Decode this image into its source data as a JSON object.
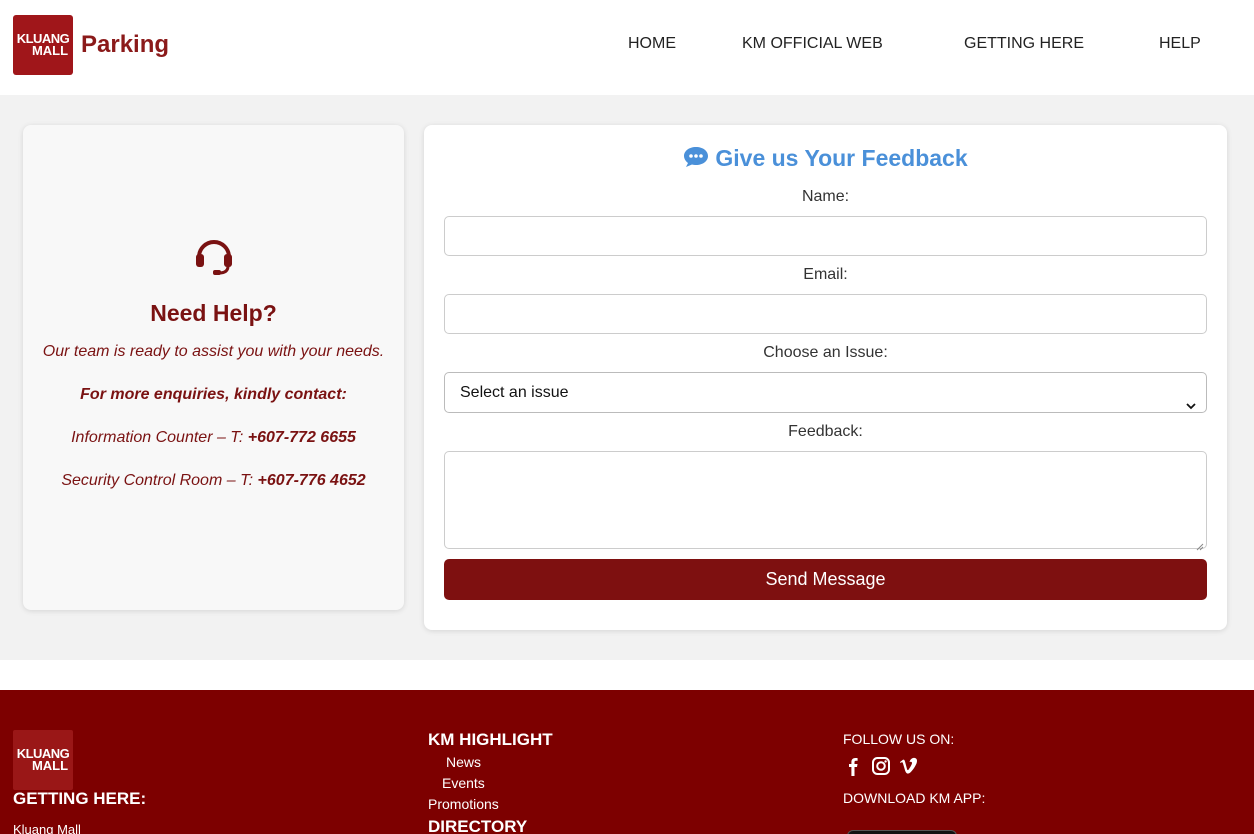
{
  "header": {
    "logo_line1": "KLUANG",
    "logo_line2": "MALL",
    "brand": "Parking",
    "nav": [
      "HOME",
      "KM OFFICIAL WEB",
      "GETTING HERE",
      "HELP"
    ]
  },
  "help": {
    "icon": "headset-icon",
    "title": "Need Help?",
    "subtitle": "Our team is ready to assist you with your needs.",
    "enquiry": "For more enquiries, kindly contact:",
    "contacts": [
      {
        "label": "Information Counter – T: ",
        "phone": "+607-772 6655"
      },
      {
        "label": "Security Control Room – T: ",
        "phone": "+607-776 4652"
      }
    ]
  },
  "form": {
    "title": "Give us Your Feedback",
    "title_icon": "chat-bubble-icon",
    "name_label": "Name:",
    "email_label": "Email:",
    "issue_label": "Choose an Issue:",
    "issue_selected": "Select an issue",
    "feedback_label": "Feedback:",
    "submit": "Send Message"
  },
  "footer": {
    "logo_line1": "KLUANG",
    "logo_line2": "MALL",
    "getting_here": "GETTING HERE:",
    "address_line": "Kluang Mall",
    "highlight_title": "KM HIGHLIGHT",
    "highlight_links": [
      "News",
      "Events",
      "Promotions"
    ],
    "directory": "DIRECTORY",
    "follow": "FOLLOW US ON:",
    "social": [
      "facebook-icon",
      "instagram-icon",
      "vimeo-icon"
    ],
    "download": "DOWNLOAD KM APP:"
  },
  "colors": {
    "brand_red": "#7d0000",
    "accent_blue": "#4a90d9",
    "button_red": "#7e1010"
  }
}
